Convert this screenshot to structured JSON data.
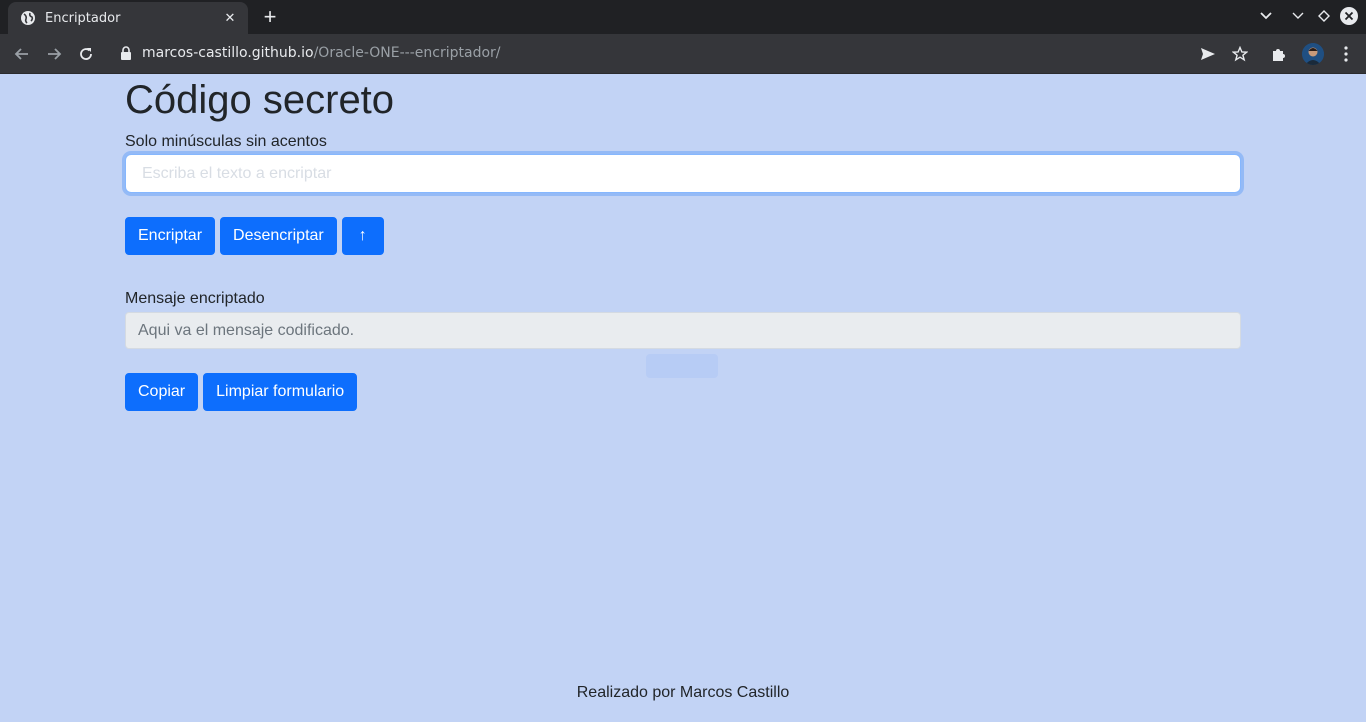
{
  "browser": {
    "tab_title": "Encriptador",
    "url_host": "marcos-castillo.github.io",
    "url_path": "/Oracle-ONE---encriptador/"
  },
  "page": {
    "title": "Código secreto",
    "input_label": "Solo minúsculas sin acentos",
    "input_placeholder": "Escriba el texto a encriptar",
    "encrypt_label": "Encriptar",
    "decrypt_label": "Desencriptar",
    "up_label": "↑",
    "output_label": "Mensaje encriptado",
    "output_placeholder": "Aqui va el mensaje codificado.",
    "copy_label": "Copiar",
    "clear_label": "Limpiar formulario",
    "footer": "Realizado por Marcos Castillo"
  },
  "colors": {
    "page_bg": "#c2d3f5",
    "button_primary": "#0d6efd",
    "chrome_dark": "#202124",
    "chrome_toolbar": "#35363a"
  }
}
